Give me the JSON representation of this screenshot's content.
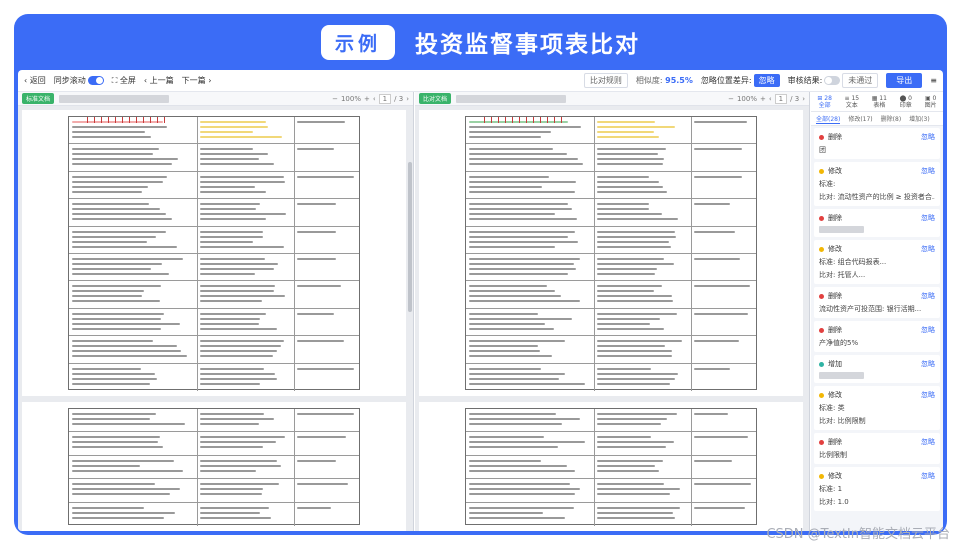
{
  "banner": {
    "pill": "示例",
    "title": "投资监督事项表比对"
  },
  "toolbar": {
    "back": "‹ 返回",
    "sync_scroll": "同步滚动",
    "fullscreen": "⛶ 全屏",
    "prev": "‹ 上一篇",
    "next": "下一篇 ›",
    "compare_rules": "比对规则",
    "similarity_label": "相似度:",
    "similarity_value": "95.5%",
    "ignore_pos_label": "忽略位置差异:",
    "ignore_pos_toggle": "忽略",
    "review_label": "审核结果:",
    "review_toggle": "未通过",
    "export": "导出",
    "menu_icon": "≡"
  },
  "left_pane": {
    "tag": "标准文档",
    "zoom": "100%",
    "page": "1",
    "total": "/ 3"
  },
  "right_pane": {
    "tag": "比对文档",
    "zoom": "100%",
    "page": "1",
    "total": "/ 3"
  },
  "side": {
    "icons": [
      {
        "count": "28",
        "label": "全部"
      },
      {
        "count": "15",
        "label": "文本"
      },
      {
        "count": "11",
        "label": "表格"
      },
      {
        "count": "0",
        "label": "印章"
      },
      {
        "count": "0",
        "label": "图片"
      }
    ],
    "tabs": [
      "全部(28)",
      "修改(17)",
      "删除(8)",
      "增加(3)"
    ],
    "cards": [
      {
        "type": "删除",
        "kind": "del",
        "action": "忽略",
        "lines": [
          "团"
        ]
      },
      {
        "type": "修改",
        "kind": "mod",
        "action": "忽略",
        "lines": [
          "标准:",
          "比对: 流动性资产的比例 ≥ 投资者合..."
        ]
      },
      {
        "type": "删除",
        "kind": "del",
        "action": "忽略",
        "lines": [
          ""
        ]
      },
      {
        "type": "修改",
        "kind": "mod",
        "action": "忽略",
        "lines": [
          "标准: 组合代码报表...",
          "比对: 托管人..."
        ]
      },
      {
        "type": "删除",
        "kind": "del",
        "action": "忽略",
        "lines": [
          "流动性资产可投范围: 银行活期..."
        ]
      },
      {
        "type": "删除",
        "kind": "del",
        "action": "忽略",
        "lines": [
          "产净值的5%"
        ]
      },
      {
        "type": "增加",
        "kind": "add",
        "action": "忽略",
        "lines": [
          ""
        ]
      },
      {
        "type": "修改",
        "kind": "mod",
        "action": "忽略",
        "lines": [
          "标准: 类",
          "比对: 比例限制"
        ]
      },
      {
        "type": "删除",
        "kind": "del",
        "action": "忽略",
        "lines": [
          "比例限制"
        ]
      },
      {
        "type": "修改",
        "kind": "mod",
        "action": "忽略",
        "lines": [
          "标准: 1",
          "比对: 1.0"
        ]
      }
    ]
  },
  "watermark": "CSDN @TextIn智能文档云平台",
  "colors": {
    "brand": "#3b6cf6",
    "delete": "#e2403f",
    "modify": "#f2b705",
    "add": "#2fb3a4",
    "tag_green": "#39b36a"
  }
}
